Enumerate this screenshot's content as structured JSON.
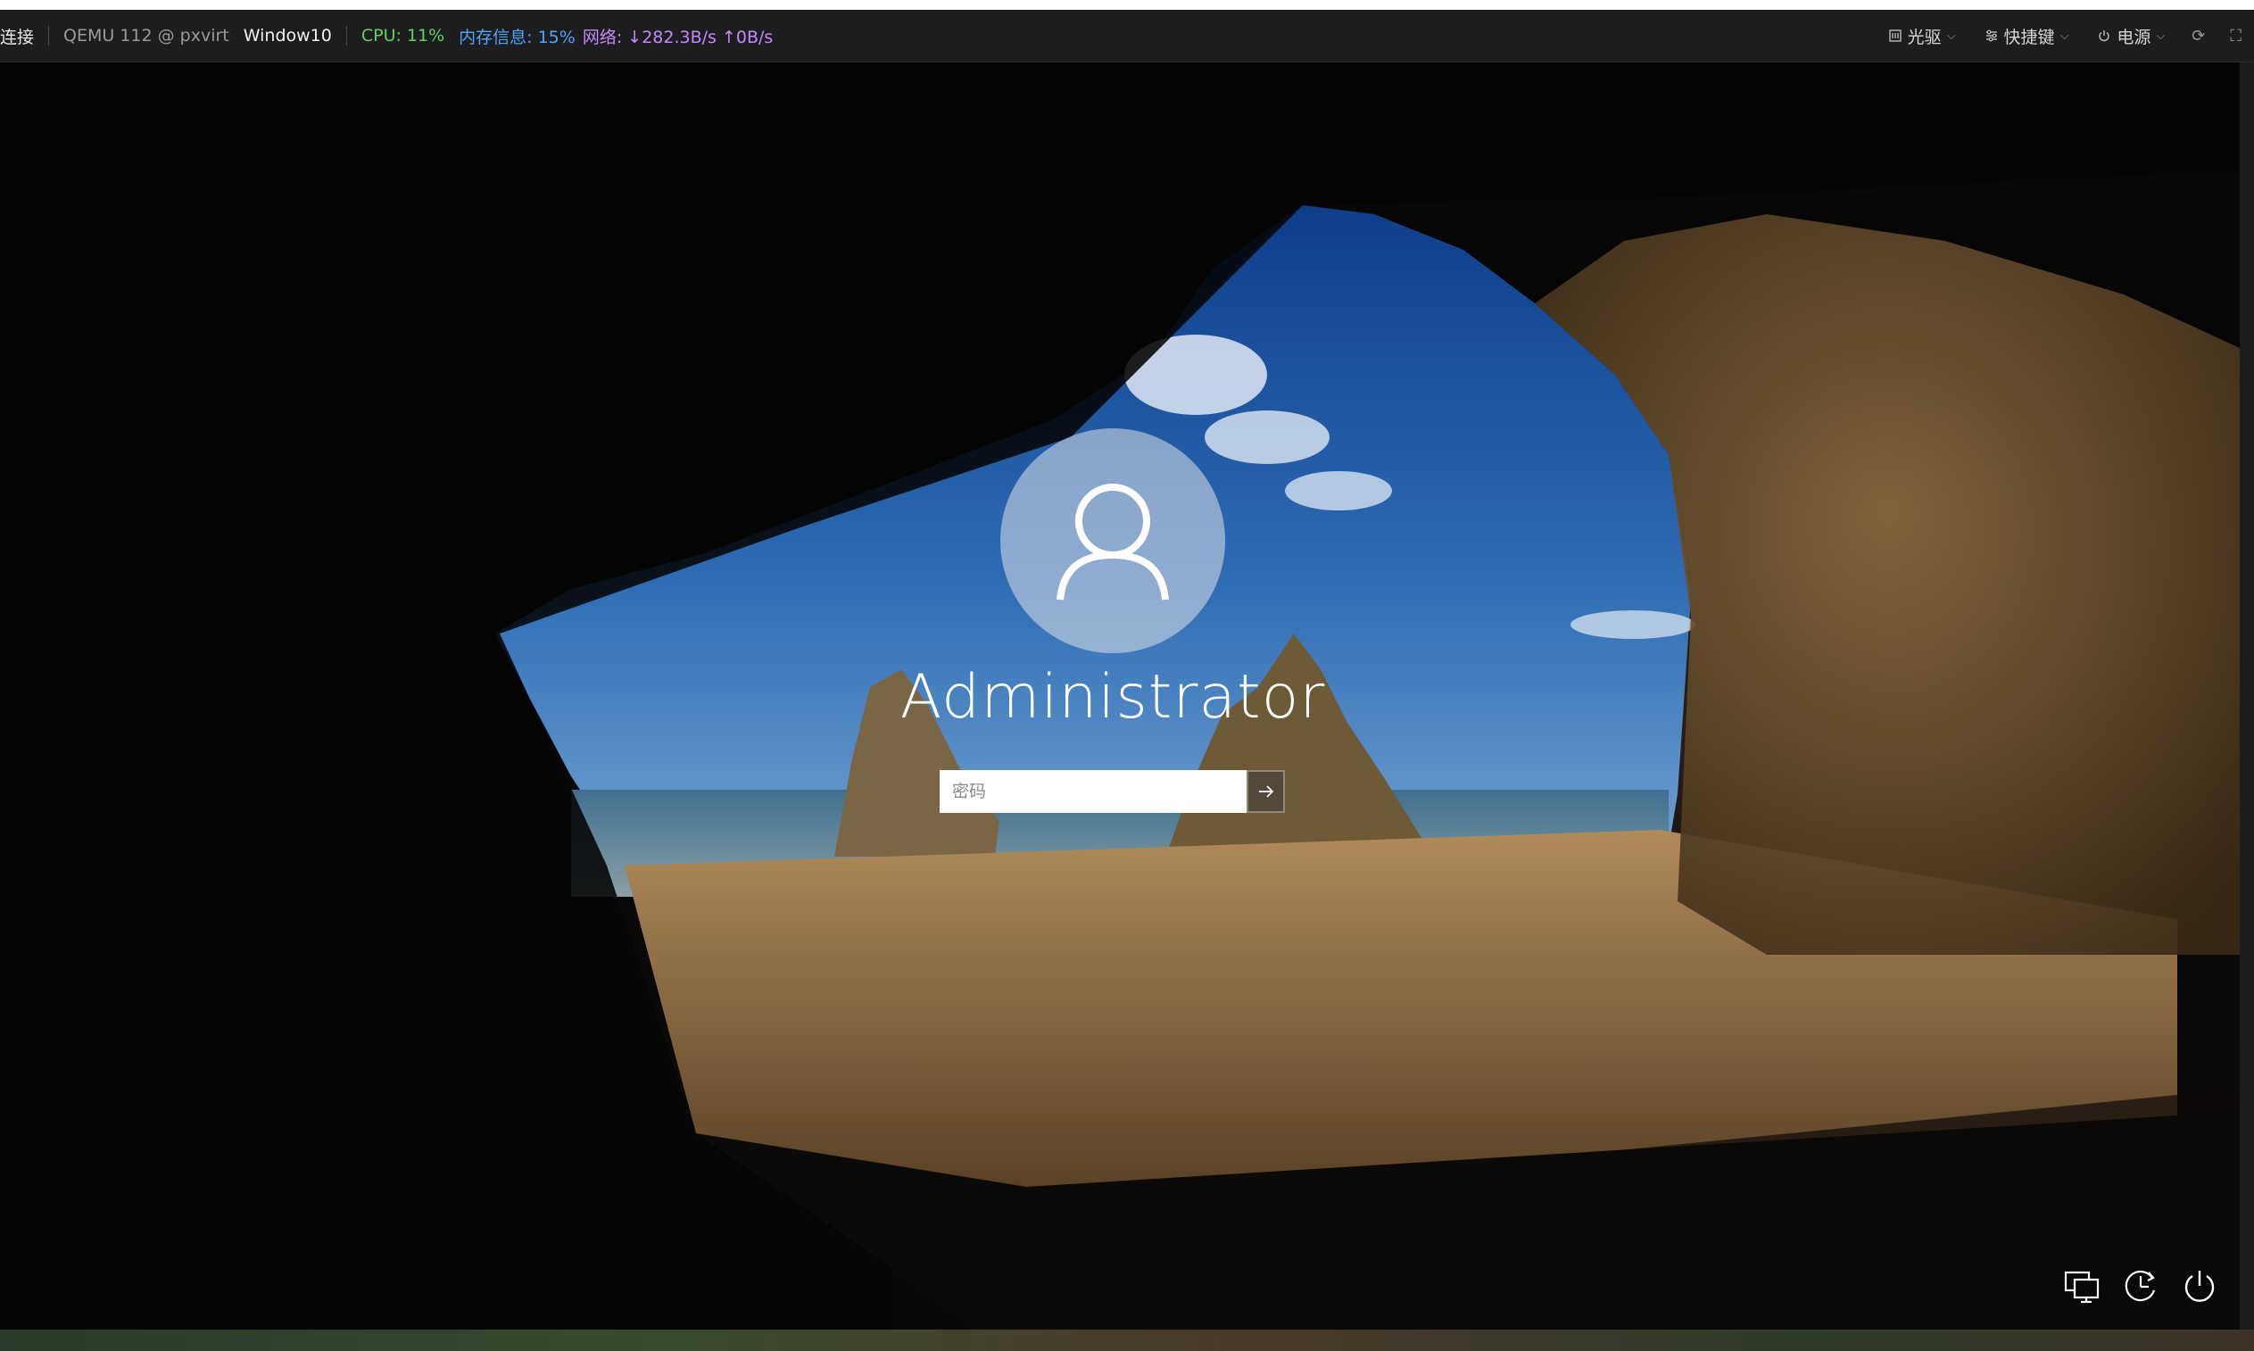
{
  "toolbar": {
    "connect": "连接",
    "host": "QEMU 112 @ pxvirt",
    "vm_name": "Window10",
    "cpu": "CPU: 11%",
    "memory": "内存信息: 15%",
    "network": "网络: ↓282.3B/s ↑0B/s",
    "cdrom_label": "光驱",
    "shortcuts_label": "快捷键",
    "power_label": "电源",
    "colors": {
      "cpu": "#5ed45e",
      "memory": "#4fa3ff",
      "network": "#c58af9"
    }
  },
  "login": {
    "username": "Administrator",
    "password_placeholder": "密码",
    "password_value": "",
    "submit_icon": "arrow-right-icon"
  },
  "corner": {
    "icons": [
      "network-icon",
      "ease-of-access-icon",
      "power-icon"
    ]
  }
}
